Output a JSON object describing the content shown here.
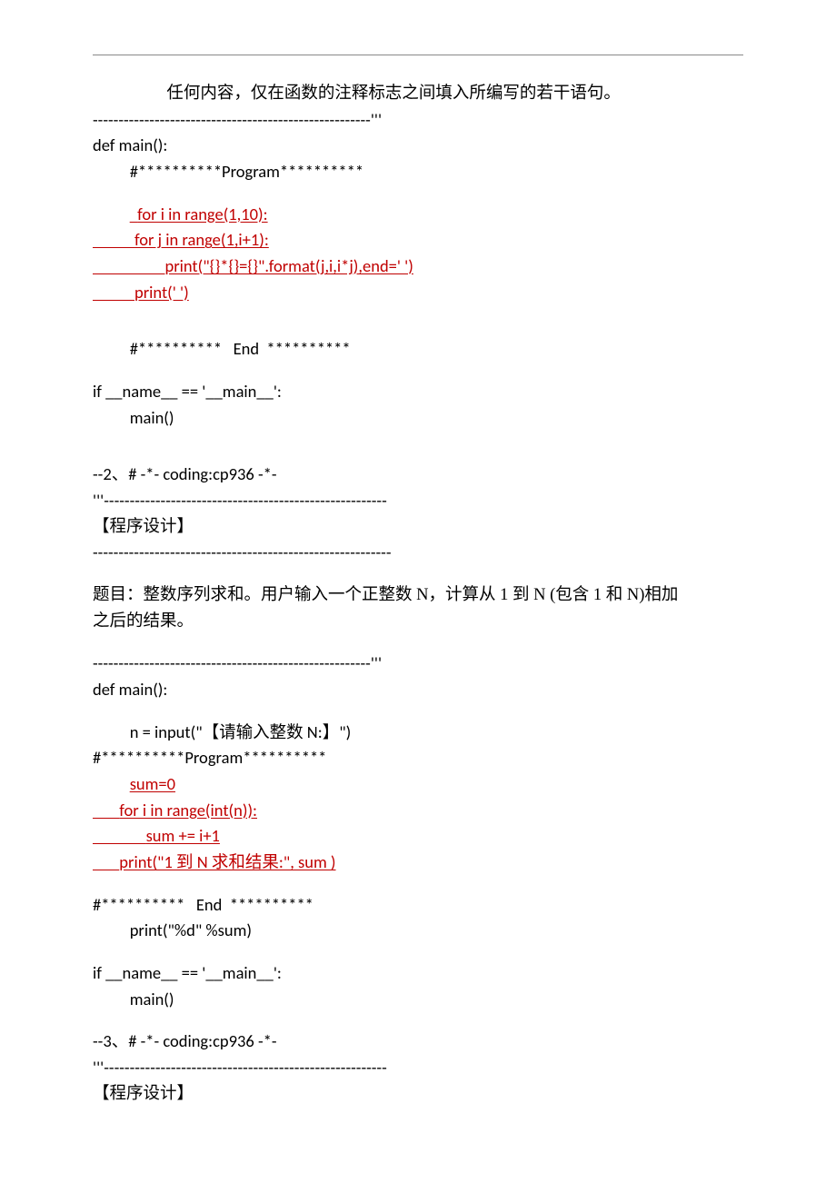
{
  "p1_intro_indent": "任何内容，仅在函数的注释标志之间填入所编写的若干语句。",
  "dashes_close_tq": "------------------------------------------------------'''",
  "def_main": "def main():",
  "comment_program_in": "#**********Program**********",
  "ans1_l1": "  for i in range(1,10):",
  "ans1_l2": "           for j in range(1,i+1):",
  "ans1_l3": "                   print(\"{}*{}={}\".format(j,i,i*j),end=' ')",
  "ans1_l4": "           print(' ')",
  "comment_end_in": "#**********   End  **********",
  "if_name": "if __name__ == '__main__':",
  "call_main": "main()",
  "q2_header": "--2、# -*- coding:cp936 -*-",
  "tq_dashes_open": "'''-------------------------------------------------------",
  "label_prog_design": "【程序设计】",
  "dashes_plain": "----------------------------------------------------------",
  "q2_desc_l1": "题目：整数序列求和。用户输入一个正整数 N，计算从 1 到 N (包含 1 和 N)相加",
  "q2_desc_l2": "之后的结果。",
  "q2_input_line": "n = input(\"【请输入整数 N:】\")",
  "comment_program_out": "#**********Program**********",
  "ans2_l1": "sum=0",
  "ans2_l2": "       for i in range(int(n)):",
  "ans2_l3": "              sum += i+1",
  "ans2_l4": "       print(\"1 到 N 求和结果:\", sum )",
  "comment_end_out": "#**********   End  **********",
  "q2_print_sum": "print(\"%d\" %sum)",
  "q3_header": "--3、# -*- coding:cp936 -*-"
}
